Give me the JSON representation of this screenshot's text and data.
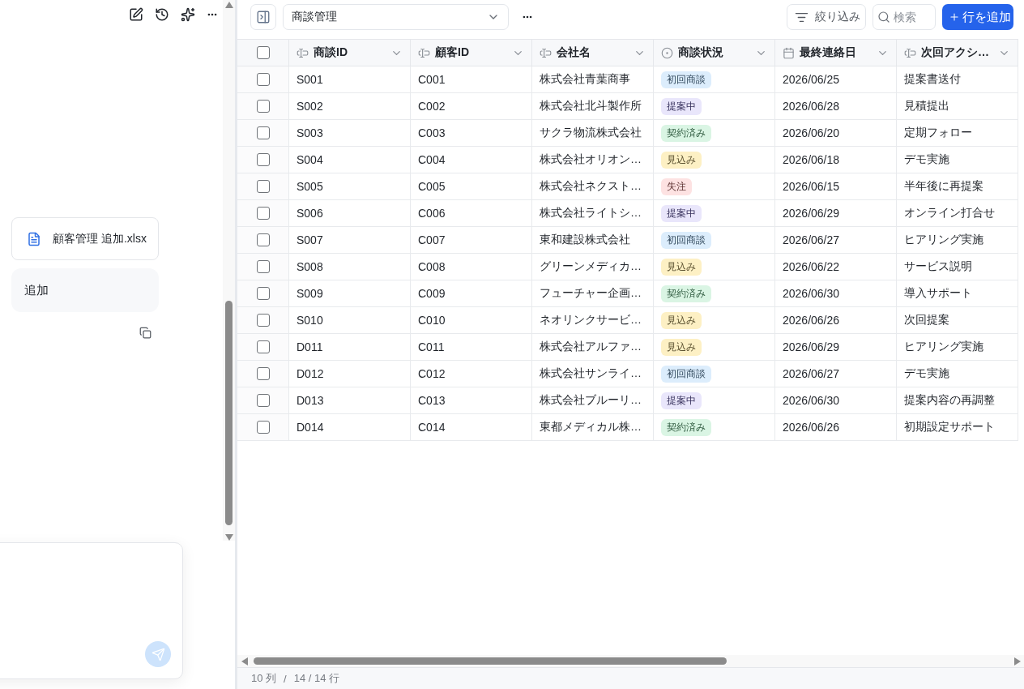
{
  "assistant_panel": {
    "attachment": {
      "file_name": "顧客管理 追加.xlsx"
    },
    "message": {
      "text": "追加"
    },
    "composer": {
      "send_disabled": true
    }
  },
  "table_view": {
    "title": "商談管理",
    "filter_button": "絞り込み",
    "search": {
      "placeholder": "検索"
    },
    "add_button": "行を追加",
    "select_all": {
      "checked": false
    },
    "columns": [
      {
        "label": "商談ID",
        "kind": "text"
      },
      {
        "label": "顧客ID",
        "kind": "text"
      },
      {
        "label": "会社名",
        "kind": "text"
      },
      {
        "label": "商談状況",
        "kind": "status"
      },
      {
        "label": "最終連絡日",
        "kind": "date"
      },
      {
        "label": "次回アクシ…",
        "kind": "text"
      }
    ],
    "rows": [
      {
        "checked": false,
        "deal_id": "S001",
        "customer_id": "C001",
        "company": "株式会社青葉商事",
        "status": {
          "label": "初回商談",
          "color": "#dcedfc"
        },
        "last_contact": "2026/06/25",
        "next_action": "提案書送付"
      },
      {
        "checked": false,
        "deal_id": "S002",
        "customer_id": "C002",
        "company": "株式会社北斗製作所",
        "status": {
          "label": "提案中",
          "color": "#e9e6fb"
        },
        "last_contact": "2026/06/28",
        "next_action": "見積提出"
      },
      {
        "checked": false,
        "deal_id": "S003",
        "customer_id": "C003",
        "company": "サクラ物流株式会社",
        "status": {
          "label": "契約済み",
          "color": "#daf5e4"
        },
        "last_contact": "2026/06/20",
        "next_action": "定期フォロー"
      },
      {
        "checked": false,
        "deal_id": "S004",
        "customer_id": "C004",
        "company": "株式会社オリオン…",
        "status": {
          "label": "見込み",
          "color": "#fdf0c4"
        },
        "last_contact": "2026/06/18",
        "next_action": "デモ実施"
      },
      {
        "checked": false,
        "deal_id": "S005",
        "customer_id": "C005",
        "company": "株式会社ネクスト…",
        "status": {
          "label": "失注",
          "color": "#fde2e2"
        },
        "last_contact": "2026/06/15",
        "next_action": "半年後に再提案"
      },
      {
        "checked": false,
        "deal_id": "S006",
        "customer_id": "C006",
        "company": "株式会社ライトシ…",
        "status": {
          "label": "提案中",
          "color": "#e9e6fb"
        },
        "last_contact": "2026/06/29",
        "next_action": "オンライン打合せ"
      },
      {
        "checked": false,
        "deal_id": "S007",
        "customer_id": "C007",
        "company": "東和建設株式会社",
        "status": {
          "label": "初回商談",
          "color": "#dcedfc"
        },
        "last_contact": "2026/06/27",
        "next_action": "ヒアリング実施"
      },
      {
        "checked": false,
        "deal_id": "S008",
        "customer_id": "C008",
        "company": "グリーンメディカ…",
        "status": {
          "label": "見込み",
          "color": "#fdf0c4"
        },
        "last_contact": "2026/06/22",
        "next_action": "サービス説明"
      },
      {
        "checked": false,
        "deal_id": "S009",
        "customer_id": "C009",
        "company": "フューチャー企画…",
        "status": {
          "label": "契約済み",
          "color": "#daf5e4"
        },
        "last_contact": "2026/06/30",
        "next_action": "導入サポート"
      },
      {
        "checked": false,
        "deal_id": "S010",
        "customer_id": "C010",
        "company": "ネオリンクサービ…",
        "status": {
          "label": "見込み",
          "color": "#fdf0c4"
        },
        "last_contact": "2026/06/26",
        "next_action": "次回提案"
      },
      {
        "checked": false,
        "deal_id": "D011",
        "customer_id": "C011",
        "company": "株式会社アルファ…",
        "status": {
          "label": "見込み",
          "color": "#fdf0c4"
        },
        "last_contact": "2026/06/29",
        "next_action": "ヒアリング実施"
      },
      {
        "checked": false,
        "deal_id": "D012",
        "customer_id": "C012",
        "company": "株式会社サンライ…",
        "status": {
          "label": "初回商談",
          "color": "#dcedfc"
        },
        "last_contact": "2026/06/27",
        "next_action": "デモ実施"
      },
      {
        "checked": false,
        "deal_id": "D013",
        "customer_id": "C013",
        "company": "株式会社ブルーリ…",
        "status": {
          "label": "提案中",
          "color": "#e9e6fb"
        },
        "last_contact": "2026/06/30",
        "next_action": "提案内容の再調整"
      },
      {
        "checked": false,
        "deal_id": "D014",
        "customer_id": "C014",
        "company": "東都メディカル株…",
        "status": {
          "label": "契約済み",
          "color": "#daf5e4"
        },
        "last_contact": "2026/06/26",
        "next_action": "初期設定サポート"
      }
    ],
    "status_bar": {
      "column_count": "10 列",
      "separator": "/",
      "row_count": "14 / 14 行"
    }
  }
}
